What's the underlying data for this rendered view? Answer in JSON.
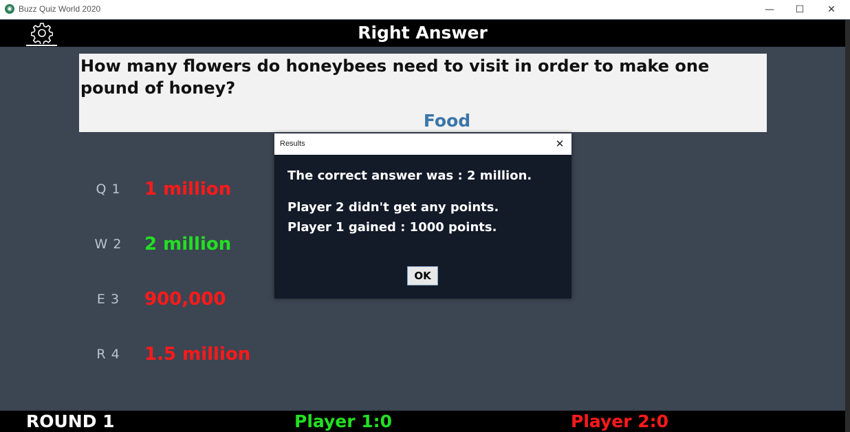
{
  "window": {
    "title": "Buzz Quiz World 2020",
    "minimize": "—",
    "maximize": "☐",
    "close": "✕"
  },
  "header": {
    "title": "Right Answer",
    "settings_icon": "gear-icon"
  },
  "question": {
    "text": "How many flowers do honeybees need to visit in order to make one pound of honey?",
    "category": "Food"
  },
  "answers": [
    {
      "key": "Q 1",
      "text": "1 million",
      "color": "#ff1a1a"
    },
    {
      "key": "W 2",
      "text": "2 million",
      "color": "#22e022"
    },
    {
      "key": "E 3",
      "text": "900,000",
      "color": "#ff1a1a"
    },
    {
      "key": "R 4",
      "text": "1.5 million",
      "color": "#ff1a1a"
    }
  ],
  "footer": {
    "round": "ROUND 1",
    "player1": "Player 1:0",
    "player2": "Player 2:0"
  },
  "dialog": {
    "title": "Results",
    "close": "✕",
    "correct_answer": "The correct answer was : 2 million.",
    "player2_result": "Player 2 didn't get any points.",
    "player1_result": "Player 1 gained : 1000 points.",
    "ok_label": "OK"
  },
  "colors": {
    "background": "#3c4552",
    "correct": "#22e022",
    "wrong": "#ff1a1a",
    "category": "#3a76a8",
    "dialog_bg": "#131a28"
  }
}
